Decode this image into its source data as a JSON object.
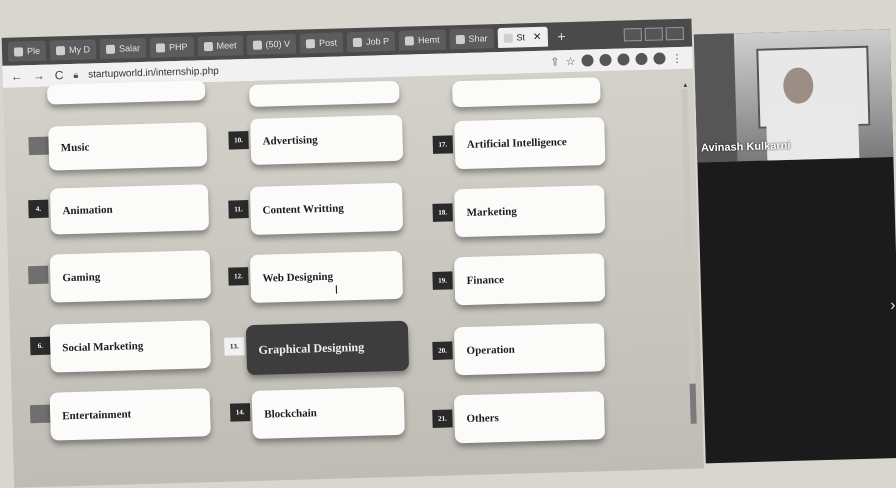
{
  "browser": {
    "tabs": [
      {
        "label": "Ple"
      },
      {
        "label": "My D"
      },
      {
        "label": "Salar"
      },
      {
        "label": "PHP"
      },
      {
        "label": "Meet"
      },
      {
        "label": "(50) V"
      },
      {
        "label": "Post"
      },
      {
        "label": "Job P"
      },
      {
        "label": "Hemt"
      },
      {
        "label": "Shar"
      },
      {
        "label": "St",
        "active": true
      }
    ],
    "url": "startupworld.in/internship.php",
    "icons": [
      "back-arrow-icon",
      "forward-arrow-icon",
      "reload-icon",
      "lock-icon",
      "share-icon",
      "star-icon",
      "extension-icon",
      "profile-icon",
      "menu-icon"
    ]
  },
  "categories": {
    "col1": [
      {
        "num": "",
        "label": "Music"
      },
      {
        "num": "4.",
        "label": "Animation"
      },
      {
        "num": "",
        "label": "Gaming"
      },
      {
        "num": "6.",
        "label": "Social Marketing"
      },
      {
        "num": "",
        "label": "Entertainment"
      }
    ],
    "col2": [
      {
        "num": "10.",
        "label": "Advertising"
      },
      {
        "num": "11.",
        "label": "Content Writting"
      },
      {
        "num": "12.",
        "label": "Web Designing"
      },
      {
        "num": "13.",
        "label": "Graphical Designing",
        "selected": true
      },
      {
        "num": "14.",
        "label": "Blockchain"
      }
    ],
    "col3": [
      {
        "num": "17.",
        "label": "Artificial Intelligence"
      },
      {
        "num": "18.",
        "label": "Marketing"
      },
      {
        "num": "19.",
        "label": "Finance"
      },
      {
        "num": "20.",
        "label": "Operation"
      },
      {
        "num": "21.",
        "label": "Others"
      }
    ]
  },
  "video": {
    "participant_name": "Avinash Kulkarni"
  }
}
